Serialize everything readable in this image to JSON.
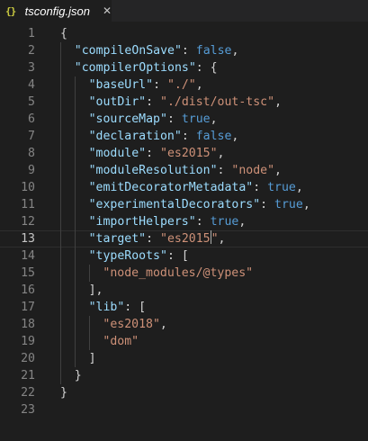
{
  "tab": {
    "icon": "{}",
    "title": "tsconfig.json",
    "close": "✕"
  },
  "lines": [
    {
      "n": "1",
      "indent": 0,
      "tokens": [
        [
          "p",
          "{"
        ]
      ]
    },
    {
      "n": "2",
      "indent": 1,
      "tokens": [
        [
          "k",
          "\"compileOnSave\""
        ],
        [
          "p",
          ": "
        ],
        [
          "b",
          "false"
        ],
        [
          "p",
          ","
        ]
      ]
    },
    {
      "n": "3",
      "indent": 1,
      "tokens": [
        [
          "k",
          "\"compilerOptions\""
        ],
        [
          "p",
          ": {"
        ]
      ]
    },
    {
      "n": "4",
      "indent": 2,
      "tokens": [
        [
          "k",
          "\"baseUrl\""
        ],
        [
          "p",
          ": "
        ],
        [
          "s",
          "\"./\""
        ],
        [
          "p",
          ","
        ]
      ]
    },
    {
      "n": "5",
      "indent": 2,
      "tokens": [
        [
          "k",
          "\"outDir\""
        ],
        [
          "p",
          ": "
        ],
        [
          "s",
          "\"./dist/out-tsc\""
        ],
        [
          "p",
          ","
        ]
      ]
    },
    {
      "n": "6",
      "indent": 2,
      "tokens": [
        [
          "k",
          "\"sourceMap\""
        ],
        [
          "p",
          ": "
        ],
        [
          "b",
          "true"
        ],
        [
          "p",
          ","
        ]
      ]
    },
    {
      "n": "7",
      "indent": 2,
      "tokens": [
        [
          "k",
          "\"declaration\""
        ],
        [
          "p",
          ": "
        ],
        [
          "b",
          "false"
        ],
        [
          "p",
          ","
        ]
      ]
    },
    {
      "n": "8",
      "indent": 2,
      "tokens": [
        [
          "k",
          "\"module\""
        ],
        [
          "p",
          ": "
        ],
        [
          "s",
          "\"es2015\""
        ],
        [
          "p",
          ","
        ]
      ]
    },
    {
      "n": "9",
      "indent": 2,
      "tokens": [
        [
          "k",
          "\"moduleResolution\""
        ],
        [
          "p",
          ": "
        ],
        [
          "s",
          "\"node\""
        ],
        [
          "p",
          ","
        ]
      ]
    },
    {
      "n": "10",
      "indent": 2,
      "tokens": [
        [
          "k",
          "\"emitDecoratorMetadata\""
        ],
        [
          "p",
          ": "
        ],
        [
          "b",
          "true"
        ],
        [
          "p",
          ","
        ]
      ]
    },
    {
      "n": "11",
      "indent": 2,
      "tokens": [
        [
          "k",
          "\"experimentalDecorators\""
        ],
        [
          "p",
          ": "
        ],
        [
          "b",
          "true"
        ],
        [
          "p",
          ","
        ]
      ]
    },
    {
      "n": "12",
      "indent": 2,
      "tokens": [
        [
          "k",
          "\"importHelpers\""
        ],
        [
          "p",
          ": "
        ],
        [
          "b",
          "true"
        ],
        [
          "p",
          ","
        ]
      ]
    },
    {
      "n": "13",
      "indent": 2,
      "current": true,
      "tokens": [
        [
          "k",
          "\"target\""
        ],
        [
          "p",
          ": "
        ],
        [
          "s",
          "\"es2015"
        ],
        [
          "caret",
          ""
        ],
        [
          "s",
          "\""
        ],
        [
          "p",
          ","
        ]
      ]
    },
    {
      "n": "14",
      "indent": 2,
      "tokens": [
        [
          "k",
          "\"typeRoots\""
        ],
        [
          "p",
          ": ["
        ]
      ]
    },
    {
      "n": "15",
      "indent": 3,
      "tokens": [
        [
          "s",
          "\"node_modules/@types\""
        ]
      ]
    },
    {
      "n": "16",
      "indent": 2,
      "tokens": [
        [
          "p",
          "],"
        ]
      ]
    },
    {
      "n": "17",
      "indent": 2,
      "tokens": [
        [
          "k",
          "\"lib\""
        ],
        [
          "p",
          ": ["
        ]
      ]
    },
    {
      "n": "18",
      "indent": 3,
      "tokens": [
        [
          "s",
          "\"es2018\""
        ],
        [
          "p",
          ","
        ]
      ]
    },
    {
      "n": "19",
      "indent": 3,
      "tokens": [
        [
          "s",
          "\"dom\""
        ]
      ]
    },
    {
      "n": "20",
      "indent": 2,
      "tokens": [
        [
          "p",
          "]"
        ]
      ]
    },
    {
      "n": "21",
      "indent": 1,
      "tokens": [
        [
          "p",
          "}"
        ]
      ]
    },
    {
      "n": "22",
      "indent": 0,
      "tokens": [
        [
          "p",
          "}"
        ]
      ]
    },
    {
      "n": "23",
      "indent": 0,
      "tokens": []
    }
  ]
}
